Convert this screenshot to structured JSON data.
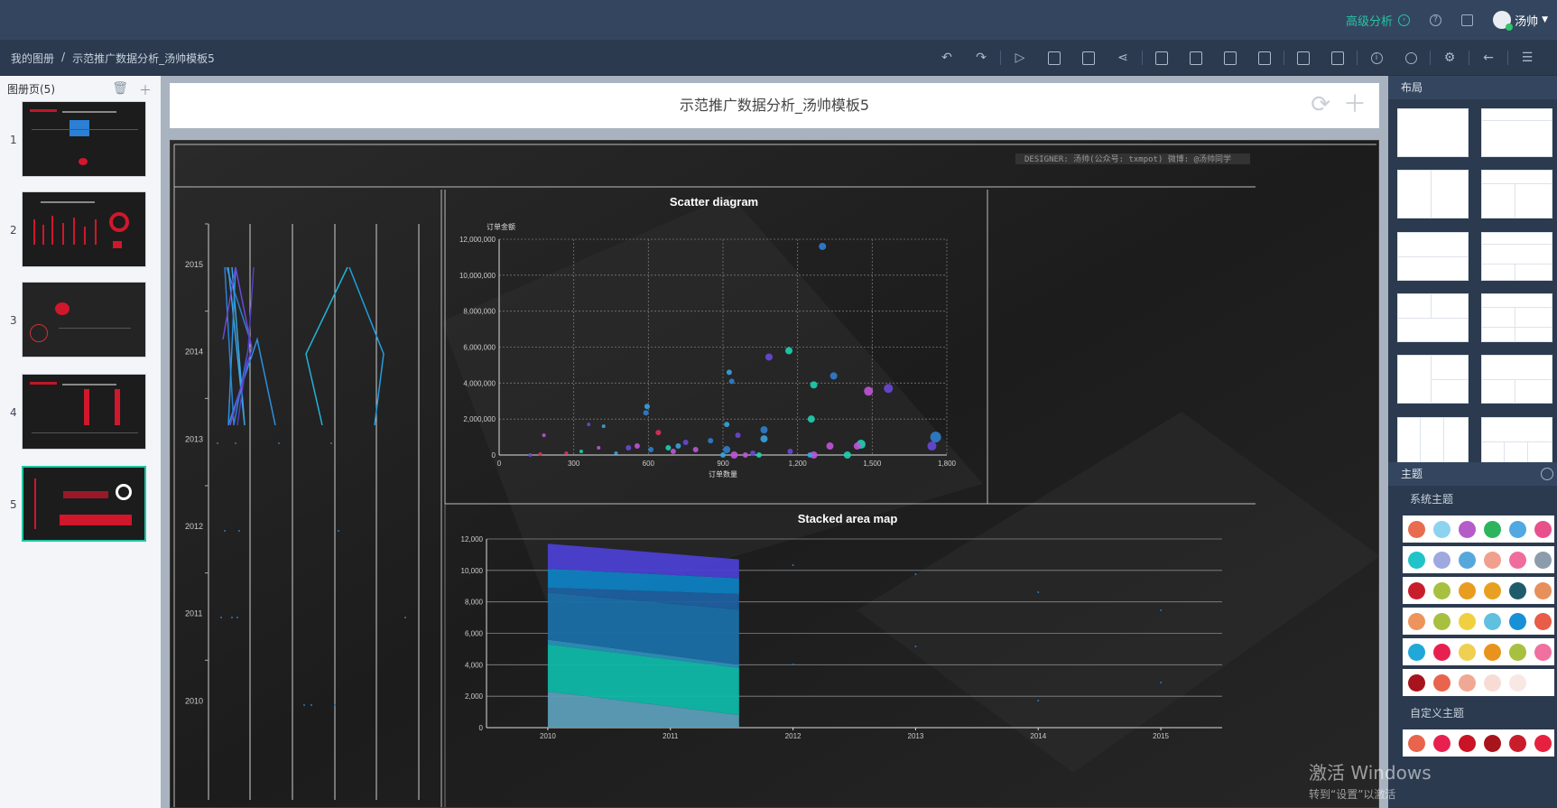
{
  "topbar": {
    "advanced_label": "高级分析",
    "user_name": "汤帅"
  },
  "breadcrumb": {
    "root": "我的图册",
    "separator": "/",
    "current": "示范推广数据分析_汤帅模板5"
  },
  "left_panel": {
    "header": "图册页(5)",
    "pages": [
      "1",
      "2",
      "3",
      "4",
      "5"
    ],
    "active_page": 5
  },
  "canvas": {
    "title": "示范推广数据分析_汤帅模板5",
    "designer_note": "DESIGNER: 汤帅(公众号: txmpot)   微博: @汤帅同学"
  },
  "parallel_chart": {
    "years": [
      "2015",
      "2014",
      "2013",
      "2012",
      "2011",
      "2010"
    ]
  },
  "chart_data": [
    {
      "type": "scatter",
      "title": "Scatter diagram",
      "xlabel": "订单数量",
      "ylabel": "订单金额",
      "xlim": [
        0,
        1800
      ],
      "ylim": [
        0,
        12000000
      ],
      "x_ticks": [
        "0",
        "300",
        "600",
        "900",
        "1,200",
        "1,500",
        "1,800"
      ],
      "y_ticks": [
        "0",
        "2,000,000",
        "4,000,000",
        "6,000,000",
        "8,000,000",
        "10,000,000",
        "12,000,000"
      ],
      "grid": true,
      "points": [
        {
          "x": 1300,
          "y": 11600000,
          "c": "#2f7fd0",
          "s": 4
        },
        {
          "x": 1165,
          "y": 5800000,
          "c": "#1dd3b0",
          "s": 4
        },
        {
          "x": 1085,
          "y": 5450000,
          "c": "#6a48d8",
          "s": 4
        },
        {
          "x": 925,
          "y": 4600000,
          "c": "#3aa3e0",
          "s": 3
        },
        {
          "x": 935,
          "y": 4100000,
          "c": "#2f7fd0",
          "s": 3
        },
        {
          "x": 1265,
          "y": 3900000,
          "c": "#1dd3b0",
          "s": 4
        },
        {
          "x": 1345,
          "y": 4400000,
          "c": "#2f7fd0",
          "s": 4
        },
        {
          "x": 1485,
          "y": 3550000,
          "c": "#c054d8",
          "s": 5
        },
        {
          "x": 1565,
          "y": 3700000,
          "c": "#6a48d8",
          "s": 5
        },
        {
          "x": 595,
          "y": 2700000,
          "c": "#3aa3e0",
          "s": 3
        },
        {
          "x": 590,
          "y": 2350000,
          "c": "#2f7fd0",
          "s": 3
        },
        {
          "x": 1255,
          "y": 2000000,
          "c": "#1dd3b0",
          "s": 4
        },
        {
          "x": 915,
          "y": 1700000,
          "c": "#3aa3e0",
          "s": 3
        },
        {
          "x": 1065,
          "y": 1400000,
          "c": "#2f7fd0",
          "s": 4
        },
        {
          "x": 960,
          "y": 1100000,
          "c": "#6a48d8",
          "s": 3
        },
        {
          "x": 640,
          "y": 1250000,
          "c": "#e0305a",
          "s": 3
        },
        {
          "x": 1065,
          "y": 900000,
          "c": "#3aa3e0",
          "s": 4
        },
        {
          "x": 1755,
          "y": 1000000,
          "c": "#2f7fd0",
          "s": 6
        },
        {
          "x": 1740,
          "y": 500000,
          "c": "#6a48d8",
          "s": 5
        },
        {
          "x": 1455,
          "y": 600000,
          "c": "#1dd3b0",
          "s": 5
        },
        {
          "x": 1440,
          "y": 500000,
          "c": "#c054d8",
          "s": 4
        },
        {
          "x": 1330,
          "y": 500000,
          "c": "#c054d8",
          "s": 4
        },
        {
          "x": 1400,
          "y": 0,
          "c": "#1dd3b0",
          "s": 4
        },
        {
          "x": 1265,
          "y": 0,
          "c": "#c054d8",
          "s": 4
        },
        {
          "x": 1250,
          "y": 0,
          "c": "#3aa3e0",
          "s": 3
        },
        {
          "x": 1170,
          "y": 200000,
          "c": "#6a48d8",
          "s": 3
        },
        {
          "x": 1045,
          "y": 0,
          "c": "#1dd3b0",
          "s": 3
        },
        {
          "x": 1020,
          "y": 100000,
          "c": "#6a48d8",
          "s": 3
        },
        {
          "x": 990,
          "y": 0,
          "c": "#c054d8",
          "s": 3
        },
        {
          "x": 945,
          "y": 0,
          "c": "#c054d8",
          "s": 4
        },
        {
          "x": 915,
          "y": 300000,
          "c": "#2f7fd0",
          "s": 4
        },
        {
          "x": 900,
          "y": 0,
          "c": "#3aa3e0",
          "s": 3
        },
        {
          "x": 850,
          "y": 800000,
          "c": "#2f7fd0",
          "s": 3
        },
        {
          "x": 790,
          "y": 300000,
          "c": "#c054d8",
          "s": 3
        },
        {
          "x": 750,
          "y": 700000,
          "c": "#6a48d8",
          "s": 3
        },
        {
          "x": 720,
          "y": 500000,
          "c": "#3aa3e0",
          "s": 3
        },
        {
          "x": 700,
          "y": 200000,
          "c": "#c054d8",
          "s": 3
        },
        {
          "x": 680,
          "y": 400000,
          "c": "#1dd3b0",
          "s": 3
        },
        {
          "x": 610,
          "y": 300000,
          "c": "#2f7fd0",
          "s": 3
        },
        {
          "x": 555,
          "y": 500000,
          "c": "#c054d8",
          "s": 3
        },
        {
          "x": 520,
          "y": 400000,
          "c": "#6a48d8",
          "s": 3
        },
        {
          "x": 470,
          "y": 100000,
          "c": "#3aa3e0",
          "s": 2
        },
        {
          "x": 420,
          "y": 1600000,
          "c": "#3aa3e0",
          "s": 2
        },
        {
          "x": 400,
          "y": 400000,
          "c": "#c054d8",
          "s": 2
        },
        {
          "x": 360,
          "y": 1700000,
          "c": "#6a48d8",
          "s": 2
        },
        {
          "x": 330,
          "y": 200000,
          "c": "#1dd3b0",
          "s": 2
        },
        {
          "x": 270,
          "y": 100000,
          "c": "#e0305a",
          "s": 2
        },
        {
          "x": 180,
          "y": 1100000,
          "c": "#c054d8",
          "s": 2
        },
        {
          "x": 165,
          "y": 50000,
          "c": "#e0305a",
          "s": 2
        },
        {
          "x": 125,
          "y": 0,
          "c": "#6a48d8",
          "s": 2
        }
      ]
    },
    {
      "type": "area",
      "title": "Stacked area map",
      "categories": [
        "2010",
        "2011",
        "2012",
        "2013",
        "2014",
        "2015"
      ],
      "ylim": [
        0,
        12000
      ],
      "y_ticks": [
        "0",
        "2,000",
        "4,000",
        "6,000",
        "8,000",
        "10,000",
        "12,000"
      ],
      "grid": true,
      "series": [
        {
          "values": [
            2300,
            800
          ],
          "color": "#5d9db8"
        },
        {
          "values": [
            3000,
            3000
          ],
          "color": "#0fb8a8"
        },
        {
          "values": [
            300,
            200
          ],
          "color": "#2b8fb8"
        },
        {
          "values": [
            3000,
            3500
          ],
          "color": "#1a6fa8"
        },
        {
          "values": [
            300,
            1000
          ],
          "color": "#1e5fa0"
        },
        {
          "values": [
            1200,
            1000
          ],
          "color": "#0e7fc0"
        },
        {
          "values": [
            1600,
            1200
          ],
          "color": "#4a3fd0"
        }
      ]
    }
  ],
  "right_panel": {
    "layout_header": "布局",
    "theme_header": "主题",
    "system_theme_label": "系统主题",
    "custom_theme_label": "自定义主题",
    "palettes": [
      [
        "#e86c4f",
        "#8cd3f0",
        "#b45cc8",
        "#2db55d",
        "#52a8e0",
        "#e8508c"
      ],
      [
        "#20c3c8",
        "#a0a8e0",
        "#56a8dc",
        "#f0a08c",
        "#f06c9c",
        "#8c9cac"
      ],
      [
        "#c81e2c",
        "#a8c040",
        "#e89c20",
        "#e8a020",
        "#1e5c6c",
        "#e8905c"
      ],
      [
        "#ec945c",
        "#a8c040",
        "#f0d040",
        "#60c0e0",
        "#1890d8",
        "#e85c48"
      ],
      [
        "#20a8d8",
        "#e82050",
        "#f0d050",
        "#e8941c",
        "#a8c040",
        "#f070a0"
      ],
      [
        "#a8141c",
        "#e8644c",
        "#f0a894",
        "#f8dcd4",
        "#f8e8e4"
      ]
    ],
    "custom_palettes": [
      [
        "#e8644c",
        "#e82050",
        "#c81424",
        "#a8141c",
        "#c81e2c",
        "#e82040"
      ]
    ]
  },
  "watermark": {
    "line1": "激活 Windows",
    "line2": "转到“设置”以激活"
  }
}
